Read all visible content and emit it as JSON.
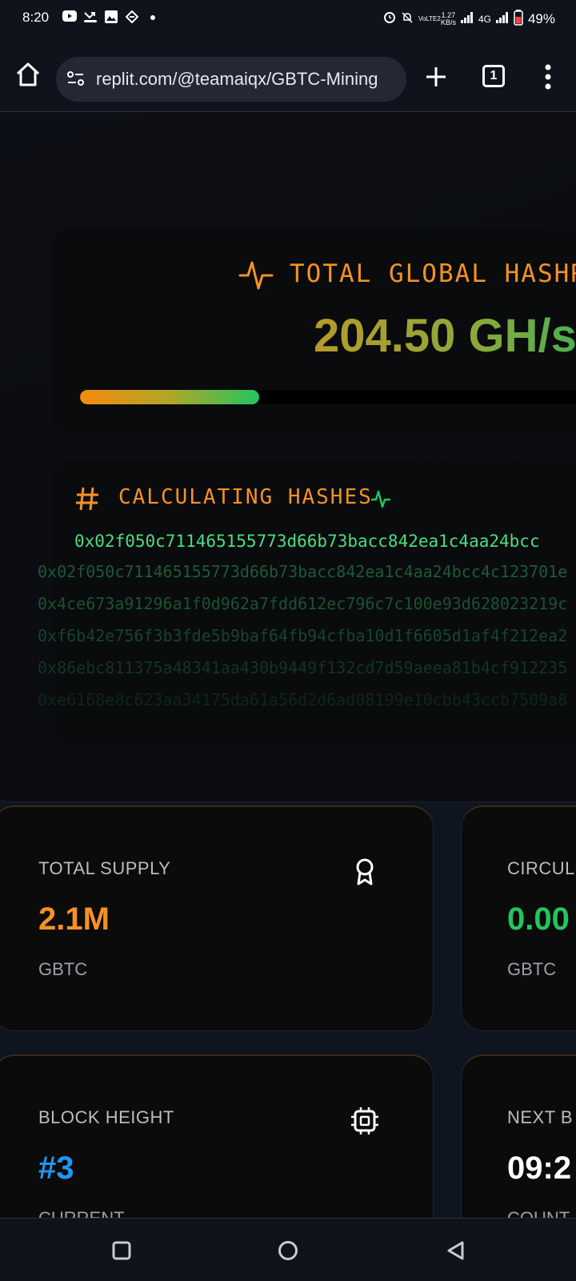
{
  "status_bar": {
    "time": "8:20",
    "network": "4G",
    "speed_value": "1.27",
    "speed_unit": "KB/s",
    "volte": "VoLTE2",
    "battery": "49%"
  },
  "browser": {
    "url": "replit.com/@teamaiqx/GBTC-Mining",
    "tab_count": "1"
  },
  "hashrate": {
    "title": "TOTAL GLOBAL HASHRA",
    "value": "204.50 GH/s",
    "progress_fraction": 0.35
  },
  "hashes": {
    "title": "CALCULATING HASHES",
    "current": "0x02f050c711465155773d66b73bacc842ea1c4aa24bcc",
    "history": [
      "0x02f050c711465155773d66b73bacc842ea1c4aa24bcc4c123701e",
      "0x4ce673a91296a1f0d962a7fdd612ec796c7c100e93d628023219c",
      "0xf6b42e756f3b3fde5b9baf64fb94cfba10d1f6605d1af4f212ea2",
      "0x86ebc811375a48341aa430b9449f132cd7d59aeea81b4cf912235",
      "0xe6168e8c623aa34175da61a56d2d6ad08199e10cbb43ccb7509a8"
    ]
  },
  "stats": [
    {
      "label": "TOTAL SUPPLY",
      "value": "2.1M",
      "unit": "GBTC",
      "color": "#f59222",
      "icon": "award-icon"
    },
    {
      "label": "CIRCUL",
      "value": "0.00",
      "unit": "GBTC",
      "color": "#22c55e",
      "icon": ""
    },
    {
      "label": "BLOCK HEIGHT",
      "value": "#3",
      "unit": "CURRENT",
      "color": "#2196f3",
      "icon": "cpu-icon"
    },
    {
      "label": "NEXT B",
      "value": "09:2",
      "unit": "COUNT",
      "color": "#ffffff",
      "icon": ""
    }
  ],
  "colors": {
    "accent_orange": "#f59222",
    "accent_green": "#22c55e",
    "accent_blue": "#2196f3"
  }
}
